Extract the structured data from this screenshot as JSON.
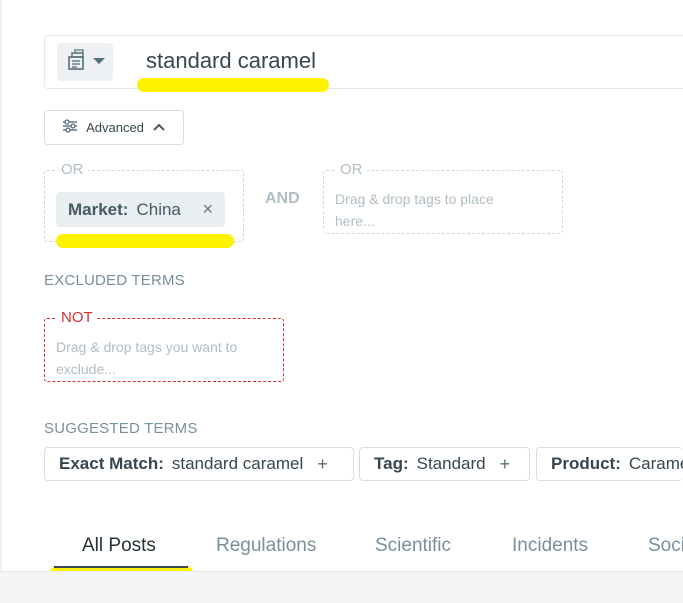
{
  "search": {
    "query": "standard caramel",
    "type_icon": "document-stack-icon"
  },
  "advanced": {
    "label": "Advanced",
    "icon": "sliders-icon",
    "chevron": "chevron-up-icon"
  },
  "groups": {
    "or_label_1": "OR",
    "or_label_2": "OR",
    "and_label": "AND",
    "tag": {
      "key": "Market:",
      "value": "China",
      "remove": "×"
    },
    "drop_placeholder": "Drag & drop tags to place here..."
  },
  "excluded": {
    "heading": "EXCLUDED TERMS",
    "not_label": "NOT",
    "placeholder": "Drag & drop tags you want to exclude..."
  },
  "suggested": {
    "heading": "SUGGESTED TERMS",
    "items": [
      {
        "key": "Exact Match:",
        "value": "standard caramel",
        "add": "+"
      },
      {
        "key": "Tag:",
        "value": "Standard",
        "add": "+"
      },
      {
        "key": "Product:",
        "value": "Caramel",
        "add": "+"
      }
    ]
  },
  "tabs": [
    {
      "label": "All Posts"
    },
    {
      "label": "Regulations"
    },
    {
      "label": "Scientific"
    },
    {
      "label": "Incidents"
    },
    {
      "label": "Social"
    }
  ],
  "colors": {
    "highlight": "#fff200",
    "excluded_border": "#d32f2f",
    "text": "#37474f"
  }
}
